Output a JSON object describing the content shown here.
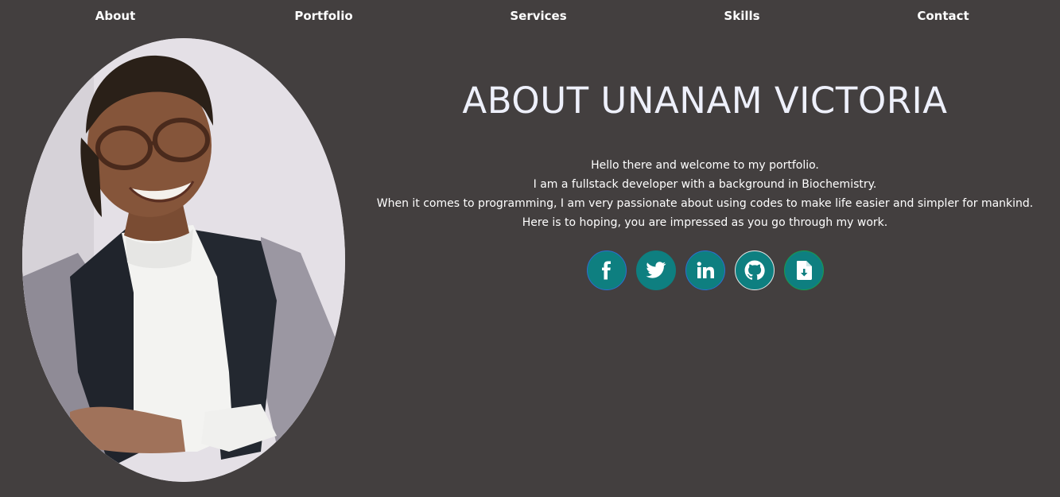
{
  "nav": {
    "items": [
      {
        "label": "About"
      },
      {
        "label": "Portfolio"
      },
      {
        "label": "Services"
      },
      {
        "label": "Skills"
      },
      {
        "label": "Contact"
      }
    ]
  },
  "about": {
    "heading": "ABOUT UNANAM VICTORIA",
    "bio_lines": [
      "Hello there and welcome to my portfolio.",
      "I am a fullstack developer with a background in Biochemistry.",
      "When it comes to programming, I am very passionate about using codes to make life easier and simpler for mankind.",
      "Here is to hoping, you are impressed as you go through my work."
    ]
  },
  "socials": [
    {
      "icon": "facebook-icon"
    },
    {
      "icon": "twitter-icon"
    },
    {
      "icon": "linkedin-icon"
    },
    {
      "icon": "github-icon"
    },
    {
      "icon": "resume-download-icon"
    }
  ],
  "colors": {
    "background": "#433f3f",
    "heading": "#eef0fb",
    "social_button": "#0e7f80"
  }
}
